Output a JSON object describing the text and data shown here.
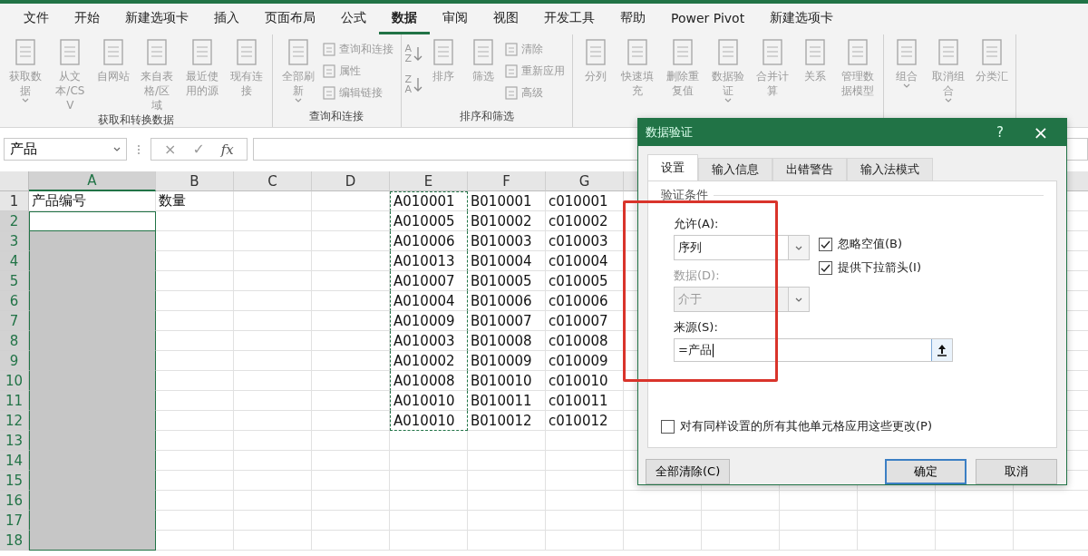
{
  "menu_tabs": [
    {
      "label": "文件",
      "selected": false
    },
    {
      "label": "开始",
      "selected": false
    },
    {
      "label": "新建选项卡",
      "selected": false
    },
    {
      "label": "插入",
      "selected": false
    },
    {
      "label": "页面布局",
      "selected": false
    },
    {
      "label": "公式",
      "selected": false
    },
    {
      "label": "数据",
      "selected": true
    },
    {
      "label": "审阅",
      "selected": false
    },
    {
      "label": "视图",
      "selected": false
    },
    {
      "label": "开发工具",
      "selected": false
    },
    {
      "label": "帮助",
      "selected": false
    },
    {
      "label": "Power Pivot",
      "selected": false
    },
    {
      "label": "新建选项卡",
      "selected": false
    }
  ],
  "ribbon": {
    "disabled": true,
    "groups": [
      {
        "label": "获取和转换数据",
        "buttons": [
          {
            "kind": "large",
            "label": "获取数据",
            "menu": true
          },
          {
            "kind": "large",
            "label": "从文本/CSV",
            "menu": false
          },
          {
            "kind": "large",
            "label": "自网站",
            "menu": false
          },
          {
            "kind": "large",
            "label": "来自表格/区域",
            "menu": false
          },
          {
            "kind": "large",
            "label": "最近使用的源",
            "menu": false
          },
          {
            "kind": "large",
            "label": "现有连接",
            "menu": false
          }
        ]
      },
      {
        "label": "查询和连接",
        "buttons": [
          {
            "kind": "large",
            "label": "全部刷新",
            "menu": true
          },
          {
            "kind": "small",
            "label": "查询和连接"
          },
          {
            "kind": "small",
            "label": "属性"
          },
          {
            "kind": "small",
            "label": "编辑链接"
          }
        ]
      },
      {
        "label": "排序和筛选",
        "buttons": [
          {
            "kind": "sort",
            "label": "AZ"
          },
          {
            "kind": "sort",
            "label": "ZA"
          },
          {
            "kind": "large",
            "label": "排序",
            "menu": false
          },
          {
            "kind": "large",
            "label": "筛选",
            "menu": false
          },
          {
            "kind": "small",
            "label": "清除"
          },
          {
            "kind": "small",
            "label": "重新应用"
          },
          {
            "kind": "small",
            "label": "高级"
          }
        ]
      },
      {
        "buttons": [
          {
            "kind": "large",
            "label": "分列",
            "menu": false
          },
          {
            "kind": "large",
            "label": "快速填充",
            "menu": false
          },
          {
            "kind": "large",
            "label": "删除重复值",
            "menu": false
          },
          {
            "kind": "large",
            "label": "数据验证",
            "menu": true
          },
          {
            "kind": "large",
            "label": "合并计算",
            "menu": false
          },
          {
            "kind": "large",
            "label": "关系",
            "menu": false
          },
          {
            "kind": "large",
            "label": "管理数据模型",
            "menu": false
          }
        ]
      },
      {
        "buttons": [
          {
            "kind": "large",
            "label": "组合",
            "menu": true
          },
          {
            "kind": "large",
            "label": "取消组合",
            "menu": true
          },
          {
            "kind": "large",
            "label": "分类汇",
            "menu": false
          }
        ]
      }
    ]
  },
  "formula_bar": {
    "name_box": "产品",
    "cancel": "×",
    "enter": "✓",
    "function": "fx"
  },
  "sheet": {
    "columns": [
      {
        "label": "A",
        "selected": true,
        "marquee": false
      },
      {
        "label": "B",
        "selected": false,
        "marquee": false
      },
      {
        "label": "C",
        "selected": false,
        "marquee": false
      },
      {
        "label": "D",
        "selected": false,
        "marquee": false
      },
      {
        "label": "E",
        "selected": false,
        "marquee": true
      },
      {
        "label": "F",
        "selected": false,
        "marquee": false
      },
      {
        "label": "G",
        "selected": false,
        "marquee": false
      }
    ],
    "rows": [
      {
        "number": "1",
        "selected": false,
        "marquee": true,
        "cells": [
          "产品编号",
          "数量",
          null,
          null,
          "A010001",
          "B010001",
          "c010001"
        ]
      },
      {
        "number": "2",
        "selected": true,
        "marquee": true,
        "cells": [
          null,
          null,
          null,
          null,
          "A010005",
          "B010002",
          "c010002"
        ]
      },
      {
        "number": "3",
        "selected": true,
        "marquee": true,
        "cells": [
          null,
          null,
          null,
          null,
          "A010006",
          "B010003",
          "c010003"
        ]
      },
      {
        "number": "4",
        "selected": true,
        "marquee": true,
        "cells": [
          null,
          null,
          null,
          null,
          "A010013",
          "B010004",
          "c010004"
        ]
      },
      {
        "number": "5",
        "selected": true,
        "marquee": true,
        "cells": [
          null,
          null,
          null,
          null,
          "A010007",
          "B010005",
          "c010005"
        ]
      },
      {
        "number": "6",
        "selected": true,
        "marquee": true,
        "cells": [
          null,
          null,
          null,
          null,
          "A010004",
          "B010006",
          "c010006"
        ]
      },
      {
        "number": "7",
        "selected": true,
        "marquee": true,
        "cells": [
          null,
          null,
          null,
          null,
          "A010009",
          "B010007",
          "c010007"
        ]
      },
      {
        "number": "8",
        "selected": true,
        "marquee": true,
        "cells": [
          null,
          null,
          null,
          null,
          "A010003",
          "B010008",
          "c010008"
        ]
      },
      {
        "number": "9",
        "selected": true,
        "marquee": true,
        "cells": [
          null,
          null,
          null,
          null,
          "A010002",
          "B010009",
          "c010009"
        ]
      },
      {
        "number": "10",
        "selected": true,
        "marquee": true,
        "cells": [
          null,
          null,
          null,
          null,
          "A010008",
          "B010010",
          "c010010"
        ]
      },
      {
        "number": "11",
        "selected": true,
        "marquee": true,
        "cells": [
          null,
          null,
          null,
          null,
          "A010010",
          "B010011",
          "c010011"
        ]
      },
      {
        "number": "12",
        "selected": true,
        "marquee": true,
        "cells": [
          null,
          null,
          null,
          null,
          "A010010",
          "B010012",
          "c010012"
        ]
      },
      {
        "number": "13",
        "selected": true,
        "marquee": false
      },
      {
        "number": "14",
        "selected": true,
        "marquee": false
      },
      {
        "number": "15",
        "selected": true,
        "marquee": false
      },
      {
        "number": "16",
        "selected": true,
        "marquee": false
      },
      {
        "number": "17",
        "selected": true,
        "marquee": false
      },
      {
        "number": "18",
        "selected": true,
        "marquee": false
      }
    ]
  },
  "dialog": {
    "title": "数据验证",
    "help": "?",
    "close": "×",
    "tabs": [
      {
        "label": "设置",
        "selected": true
      },
      {
        "label": "输入信息",
        "selected": false
      },
      {
        "label": "出错警告",
        "selected": false
      },
      {
        "label": "输入法模式",
        "selected": false
      }
    ],
    "section": "验证条件",
    "fields": [
      {
        "kind": "select",
        "label": "允许(A):",
        "value": "序列",
        "disabled": false
      },
      {
        "kind": "select",
        "label": "数据(D):",
        "value": "介于",
        "disabled": true
      },
      {
        "kind": "input",
        "label": "来源(S):",
        "value": "=产品",
        "disabled": false
      }
    ],
    "options": [
      {
        "label": "忽略空值(B)",
        "checked": true
      },
      {
        "label": "提供下拉箭头(I)",
        "checked": true
      }
    ],
    "apply_all": {
      "label": "对有同样设置的所有其他单元格应用这些更改(P)",
      "checked": false
    },
    "buttons": [
      {
        "label": "全部清除(C)",
        "default": false
      },
      {
        "label": "确定",
        "default": true
      },
      {
        "label": "取消",
        "default": false
      }
    ]
  }
}
